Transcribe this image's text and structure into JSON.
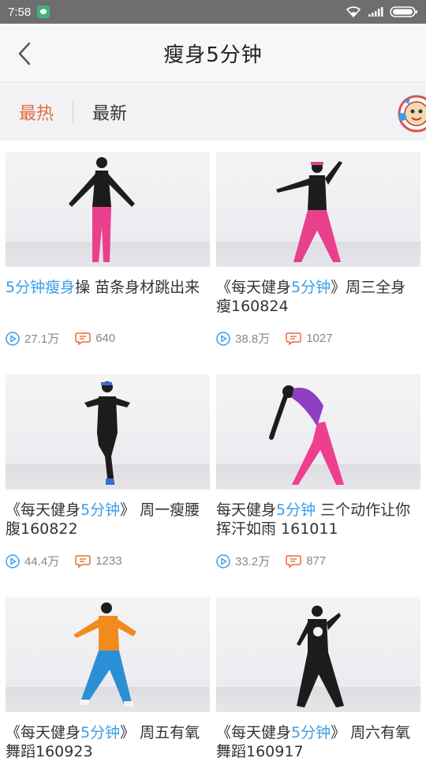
{
  "status_bar": {
    "time": "7:58"
  },
  "header": {
    "title": "瘦身5分钟"
  },
  "tabs": [
    {
      "label": "最热",
      "active": true
    },
    {
      "label": "最新",
      "active": false
    }
  ],
  "videos": [
    {
      "title_hl": "5分钟瘦身",
      "title_rest": "操 苗条身材跳出来",
      "title_pre": "",
      "views": "27.1万",
      "comments": "640"
    },
    {
      "title_pre": "《每天健身",
      "title_hl": "5分钟",
      "title_rest": "》周三全身瘦160824",
      "views": "38.8万",
      "comments": "1027"
    },
    {
      "title_pre": "《每天健身",
      "title_hl": "5分钟",
      "title_rest": "》 周一瘦腰腹160822",
      "views": "44.4万",
      "comments": "1233"
    },
    {
      "title_pre": "每天健身",
      "title_hl": "5分钟",
      "title_rest": " 三个动作让你挥汗如雨 161011",
      "views": "33.2万",
      "comments": "877"
    },
    {
      "title_pre": "《每天健身",
      "title_hl": "5分钟",
      "title_rest": "》 周五有氧舞蹈160923",
      "views": "",
      "comments": ""
    },
    {
      "title_pre": "《每天健身",
      "title_hl": "5分钟",
      "title_rest": "》 周六有氧舞蹈160917",
      "views": "",
      "comments": ""
    }
  ],
  "colors": {
    "accent": "#e56b3c",
    "highlight": "#3b9ee8",
    "status_bar": "#6e6e6e"
  }
}
